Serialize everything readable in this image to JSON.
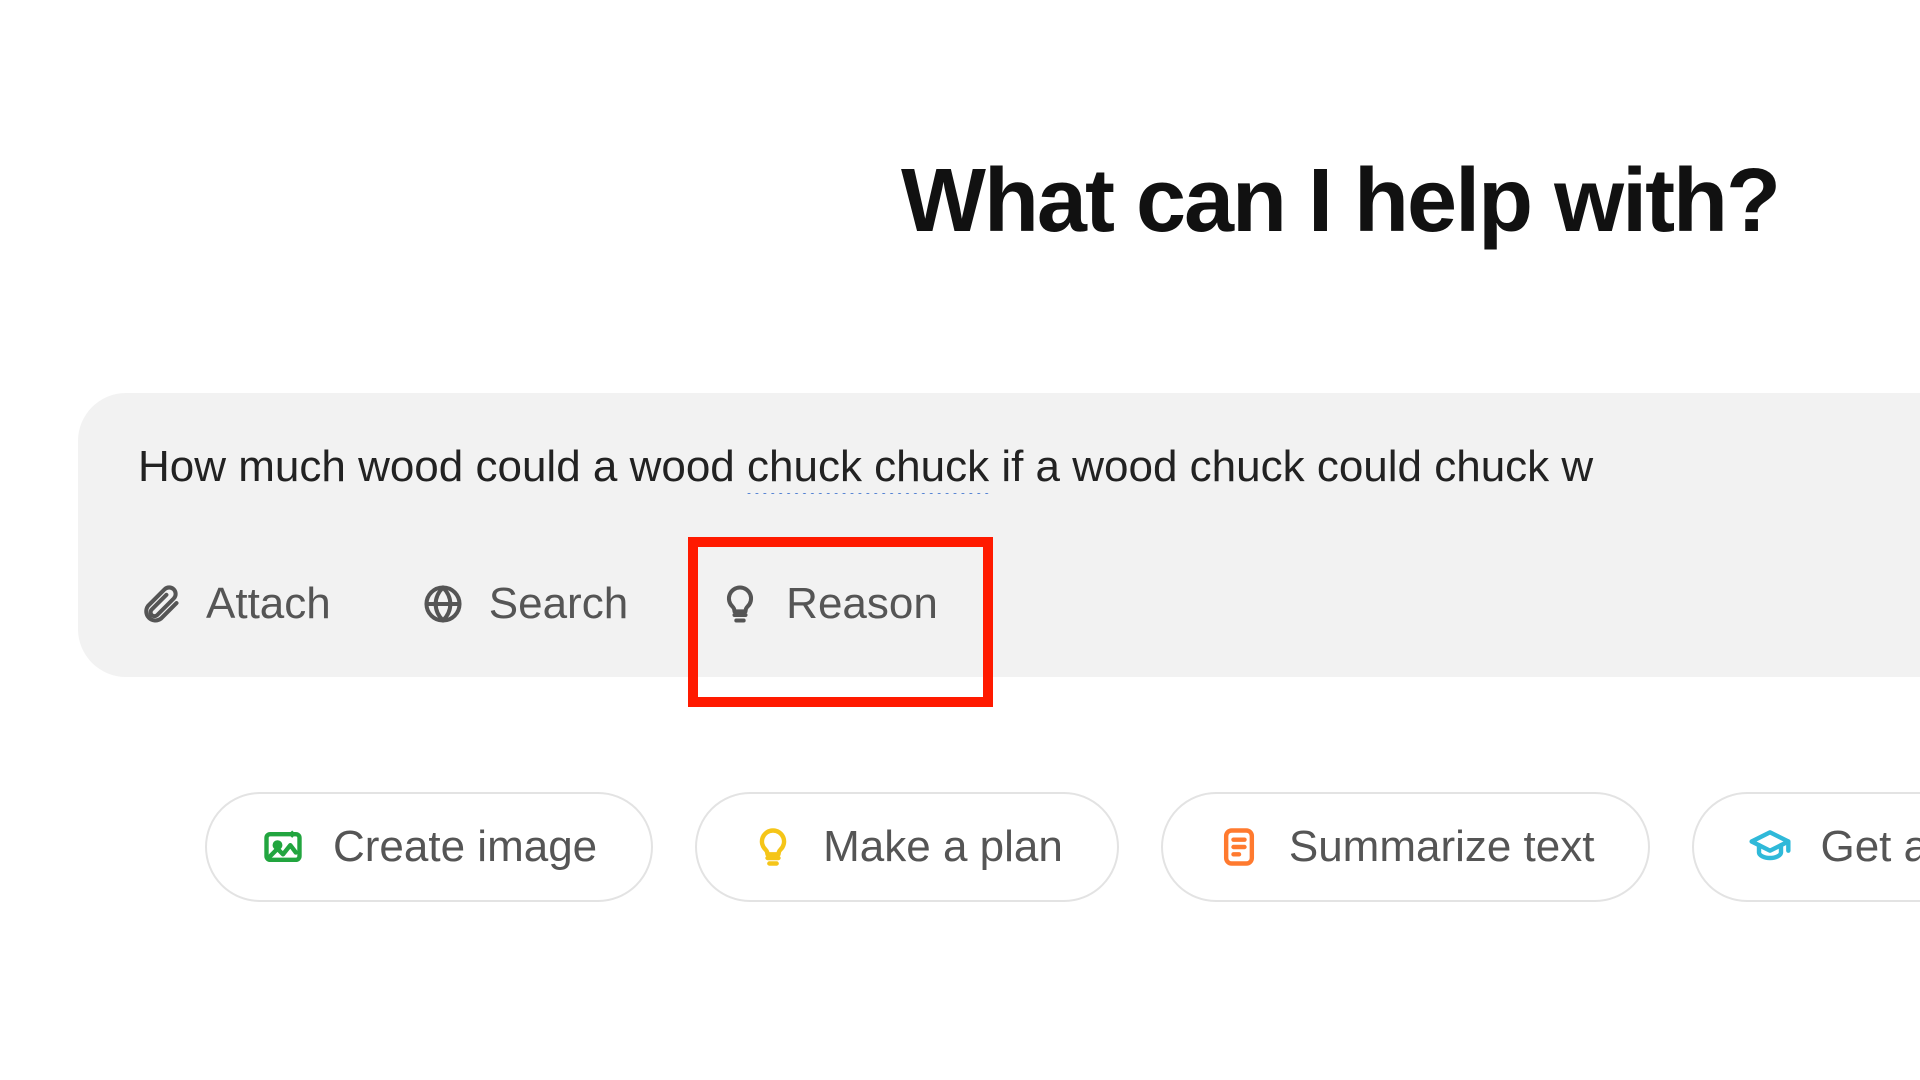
{
  "heading": "What can I help with?",
  "prompt": {
    "pre": "How much wood could a wood ",
    "spelled": "chuck chuck",
    "post": " if a wood chuck could chuck w"
  },
  "tools": {
    "attach": "Attach",
    "search": "Search",
    "reason": "Reason"
  },
  "chips": {
    "create_image": "Create image",
    "make_a_plan": "Make a plan",
    "summarize_text": "Summarize text",
    "get_advice": "Get advic"
  },
  "colors": {
    "highlight": "#ff1a00",
    "chip_image_icon": "#22a53f",
    "chip_plan_icon": "#f5c518",
    "chip_summ_icon": "#ff7a2f",
    "chip_advice_icon": "#2fb9d9"
  }
}
